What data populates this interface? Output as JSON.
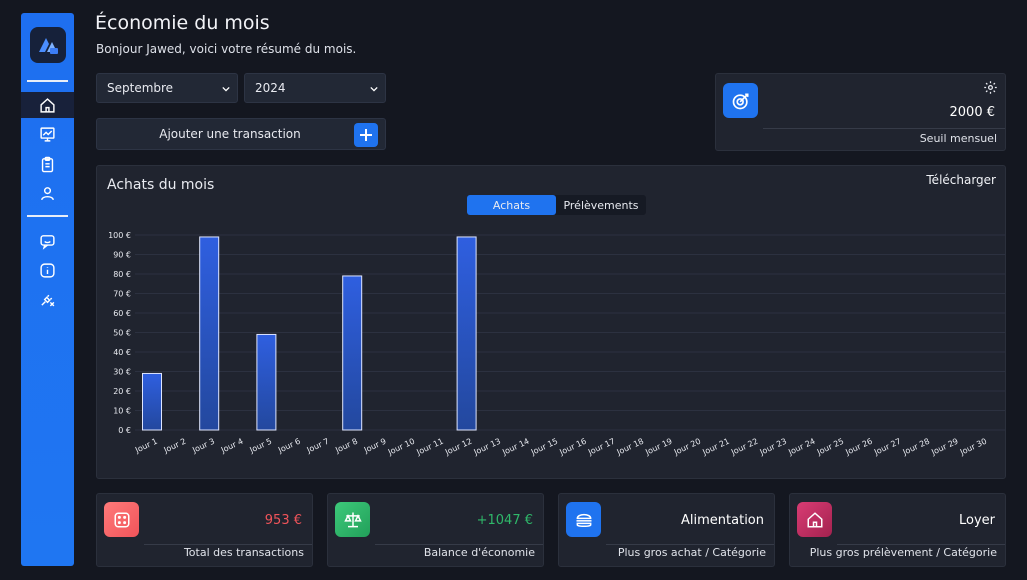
{
  "header": {
    "title": "Économie du mois",
    "subtitle": "Bonjour Jawed, voici votre résumé du mois."
  },
  "filters": {
    "month": "Septembre",
    "year": "2024"
  },
  "add_transaction": {
    "label": "Ajouter une transaction"
  },
  "threshold": {
    "value": "2000 €",
    "label": "Seuil mensuel"
  },
  "chart_header": {
    "title": "Achats du mois",
    "download": "Télécharger"
  },
  "tabs": [
    "Achats",
    "Prélèvements"
  ],
  "stats": [
    {
      "value": "953 €",
      "label": "Total des transactions",
      "color": "#f0545a"
    },
    {
      "value": "+1047 €",
      "label": "Balance d'économie",
      "color": "#2fb86a"
    },
    {
      "value": "Alimentation",
      "label": "Plus gros achat / Catégorie",
      "color": "#ffffff"
    },
    {
      "value": "Loyer",
      "label": "Plus gros prélèvement / Catégorie",
      "color": "#ffffff"
    }
  ],
  "colors": {
    "accent": "#1f73ef",
    "sidebar": "#1e6ff0",
    "bar": "#2d5bd8",
    "background": "#141720",
    "card": "#20242f"
  },
  "icons": [
    "app-logo-icon",
    "home-icon",
    "chart-icon",
    "clipboard-icon",
    "user-icon",
    "chat-icon",
    "info-icon",
    "plug-off-icon"
  ],
  "chart_data": {
    "type": "bar",
    "categories": [
      "Jour 1",
      "Jour 2",
      "Jour 3",
      "Jour 4",
      "Jour 5",
      "Jour 6",
      "Jour 7",
      "Jour 8",
      "Jour 9",
      "Jour 10",
      "Jour 11",
      "Jour 12",
      "Jour 13",
      "Jour 14",
      "Jour 15",
      "Jour 16",
      "Jour 17",
      "Jour 18",
      "Jour 19",
      "Jour 20",
      "Jour 21",
      "Jour 22",
      "Jour 23",
      "Jour 24",
      "Jour 25",
      "Jour 26",
      "Jour 27",
      "Jour 28",
      "Jour 29",
      "Jour 30"
    ],
    "values": [
      29,
      0,
      99,
      0,
      49,
      0,
      0,
      79,
      0,
      0,
      0,
      99,
      0,
      0,
      0,
      0,
      0,
      0,
      0,
      0,
      0,
      0,
      0,
      0,
      0,
      0,
      0,
      0,
      0,
      0
    ],
    "yticks": [
      "0 €",
      "10 €",
      "20 €",
      "30 €",
      "40 €",
      "50 €",
      "60 €",
      "70 €",
      "80 €",
      "90 €",
      "100 €"
    ],
    "ylim": [
      0,
      100
    ],
    "grid": true,
    "legend": "none"
  }
}
